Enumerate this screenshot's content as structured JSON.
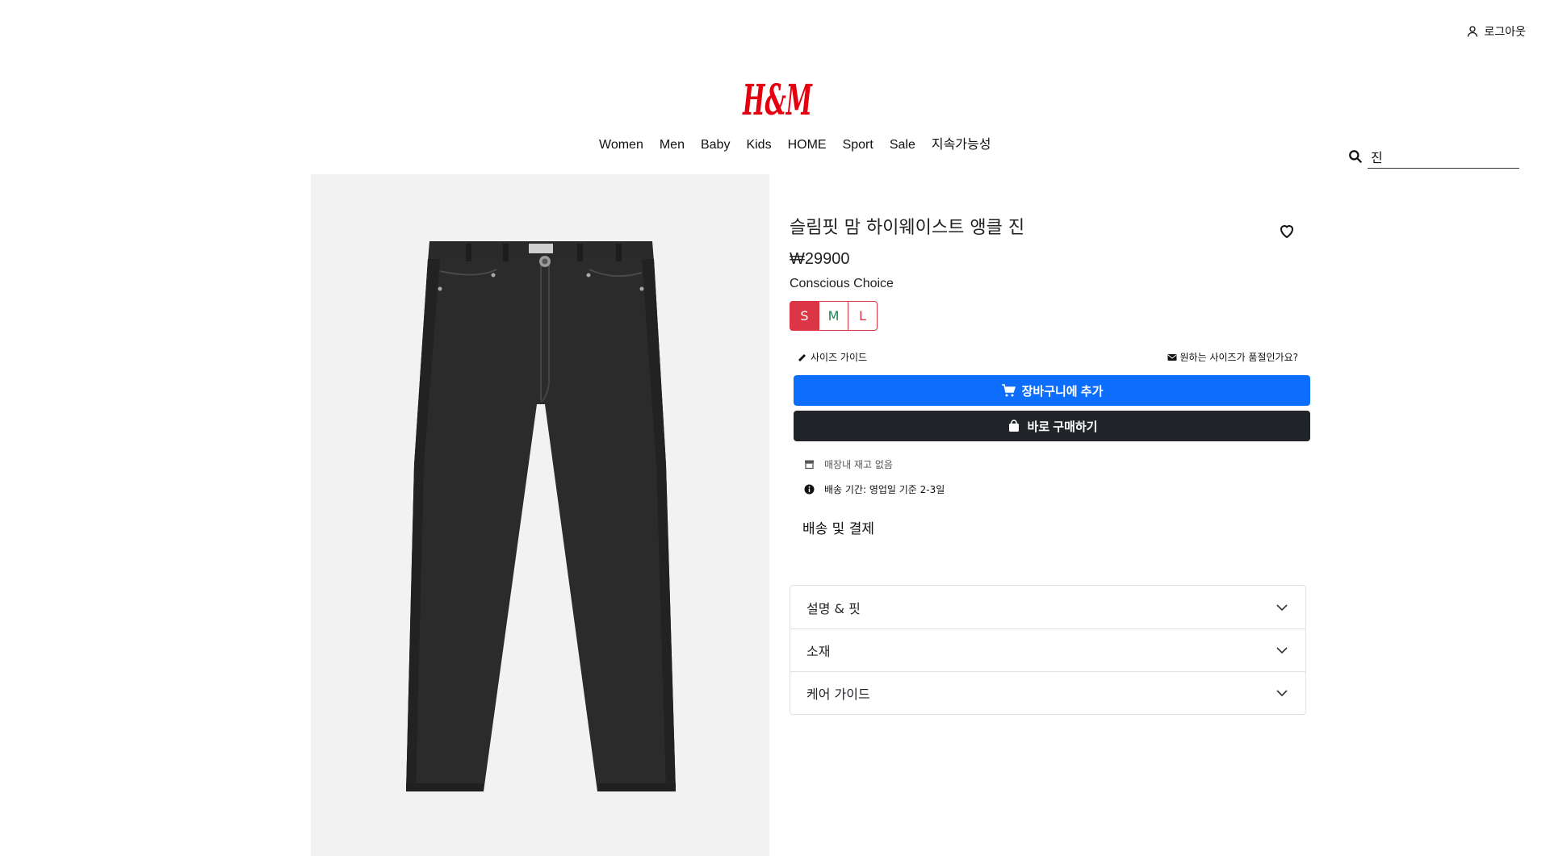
{
  "header": {
    "logout_label": "로그아웃",
    "logo_text": "H&M",
    "brand_color": "#e50010",
    "nav": [
      "Women",
      "Men",
      "Baby",
      "Kids",
      "HOME",
      "Sport",
      "Sale",
      "지속가능성"
    ],
    "search_value": "진"
  },
  "product": {
    "title": "슬림핏 맘 하이웨이스트 앵클 진",
    "price": "₩29900",
    "tag": "Conscious Choice",
    "sizes": [
      "S",
      "M",
      "L"
    ],
    "selected_size": "S",
    "size_guide": "사이즈 가이드",
    "size_soldout": "원하는 사이즈가 품절인가요?",
    "add_to_cart": "장바구니에 추가",
    "buy_now": "바로 구매하기",
    "store_stock": "매장내 재고 없음",
    "delivery_time": "배송 기간: 영업일 기준 2-3일",
    "shipping_payment": "배송 및 결제",
    "accordion": [
      "설명 & 핏",
      "소재",
      "케어 가이드"
    ]
  },
  "colors": {
    "primary": "#0d6efd",
    "dark": "#212529",
    "danger": "#dc3545",
    "image_bg": "#f2f2f2"
  }
}
